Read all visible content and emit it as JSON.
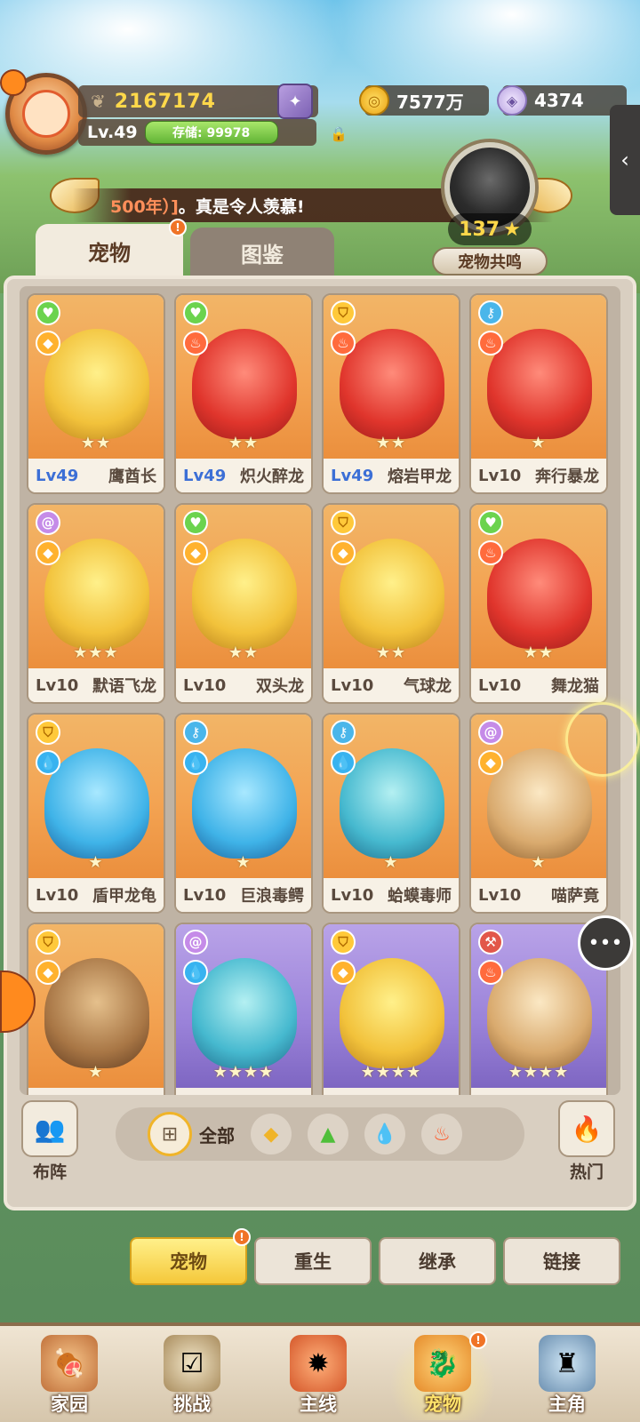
{
  "player": {
    "power": "2167174",
    "level": "Lv.49",
    "storage": "存储: 99978"
  },
  "currency": {
    "gold": "7577万",
    "shells": "4374"
  },
  "ticker": {
    "highlight": "500年）]",
    "text": "。真是令人羡慕!"
  },
  "resonance": {
    "count": "137",
    "label": "宠物共鸣"
  },
  "tabs": {
    "pets": "宠物",
    "codex": "图鉴"
  },
  "pets": [
    {
      "level": "Lv49",
      "name": "鹰酋长",
      "stars": "★★"
    },
    {
      "level": "Lv49",
      "name": "炽火醉龙",
      "stars": "★★"
    },
    {
      "level": "Lv49",
      "name": "熔岩甲龙",
      "stars": "★★"
    },
    {
      "level": "Lv10",
      "name": "奔行暴龙",
      "stars": "★"
    },
    {
      "level": "Lv10",
      "name": "默语飞龙",
      "stars": "★★★"
    },
    {
      "level": "Lv10",
      "name": "双头龙",
      "stars": "★★"
    },
    {
      "level": "Lv10",
      "name": "气球龙",
      "stars": "★★"
    },
    {
      "level": "Lv10",
      "name": "舞龙猫",
      "stars": "★★"
    },
    {
      "level": "Lv10",
      "name": "盾甲龙龟",
      "stars": "★"
    },
    {
      "level": "Lv10",
      "name": "巨浪毒鳄",
      "stars": "★"
    },
    {
      "level": "Lv10",
      "name": "蛤蟆毒师",
      "stars": "★"
    },
    {
      "level": "Lv10",
      "name": "喵萨竟",
      "stars": "★"
    },
    {
      "level": "",
      "name": "",
      "stars": "★"
    },
    {
      "level": "",
      "name": "",
      "stars": "★★★★"
    },
    {
      "level": "",
      "name": "",
      "stars": "★★★★"
    },
    {
      "level": "",
      "name": "",
      "stars": "★★★★"
    }
  ],
  "filters": {
    "formation": "布阵",
    "all": "全部",
    "hot": "热门"
  },
  "actions": {
    "pets": "宠物",
    "rebirth": "重生",
    "inherit": "继承",
    "link": "链接"
  },
  "nav": {
    "home": "家园",
    "challenge": "挑战",
    "main": "主线",
    "pets": "宠物",
    "hero": "主角"
  }
}
